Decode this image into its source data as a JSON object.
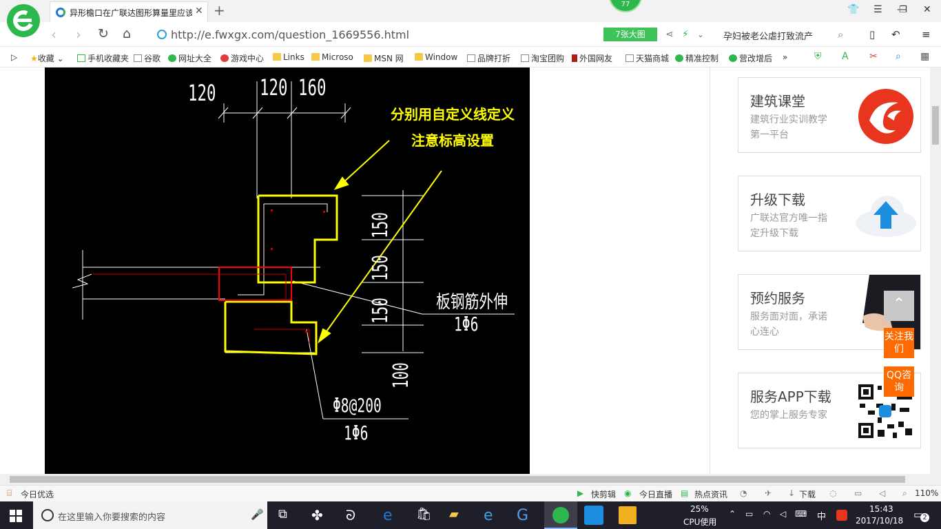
{
  "browser": {
    "tab_title": "异形檐口在广联达图形算量里应该",
    "badge_count": "77",
    "url": "http://e.fwxgx.com/question_1669556.html",
    "bigpic_label": "7张大图",
    "search_text": "孕妇被老公虐打致流产"
  },
  "bookmarks": [
    {
      "label": "收藏",
      "icon": "star-icon"
    },
    {
      "label": "手机收藏夹",
      "icon": "phone-icon"
    },
    {
      "label": "谷歌",
      "icon": "page-icon"
    },
    {
      "label": "网址大全",
      "icon": "site-icon"
    },
    {
      "label": "游戏中心",
      "icon": "game-icon"
    },
    {
      "label": "Links",
      "icon": "folder-icon"
    },
    {
      "label": "Microso",
      "icon": "folder-icon"
    },
    {
      "label": "MSN 网",
      "icon": "folder-icon"
    },
    {
      "label": "Window",
      "icon": "folder-icon"
    },
    {
      "label": "品牌打折",
      "icon": "page-icon"
    },
    {
      "label": "淘宝团购",
      "icon": "page-icon"
    },
    {
      "label": "外国网友",
      "icon": "flag-icon"
    },
    {
      "label": "天猫商城",
      "icon": "page-icon"
    },
    {
      "label": "精准控制",
      "icon": "wechat-icon"
    },
    {
      "label": "营改增后",
      "icon": "wechat-icon"
    }
  ],
  "drawing": {
    "dim_top": [
      "120",
      "120",
      "160"
    ],
    "dim_right": [
      "150",
      "150",
      "150",
      "100"
    ],
    "note_line1": "分别用自定义线定义",
    "note_line2": "注意标高设置",
    "label_slab": "板钢筋外伸",
    "label_slab_bar": "1Φ6",
    "label_stirrup": "Φ8@200",
    "label_stirrup_bar": "1Φ6"
  },
  "sidebar": {
    "cards": [
      {
        "title": "建筑课堂",
        "sub": "建筑行业实训教学第一平台"
      },
      {
        "title": "升级下载",
        "sub": "广联达官方唯一指定升级下载"
      },
      {
        "title": "预约服务",
        "sub": "服务面对面，承诺心连心"
      },
      {
        "title": "服务APP下载",
        "sub": "您的掌上服务专家"
      }
    ],
    "follow_label": "关注我们",
    "qq_label": "QQ咨询"
  },
  "statusbar": {
    "left": "今日优选",
    "items": [
      "快剪辑",
      "今日直播",
      "热点资讯",
      "下载"
    ],
    "zoom": "110%"
  },
  "taskbar": {
    "search_placeholder": "在这里输入你要搜索的内容",
    "cpu_percent": "25%",
    "cpu_label": "CPU使用",
    "ime": "中",
    "time": "15:43",
    "date": "2017/10/18",
    "notifications": "2"
  },
  "colors": {
    "accent": "#2db84d",
    "annotation": "#ffff00",
    "highlight": "#ff0000",
    "float_btn": "#ff6a00"
  }
}
